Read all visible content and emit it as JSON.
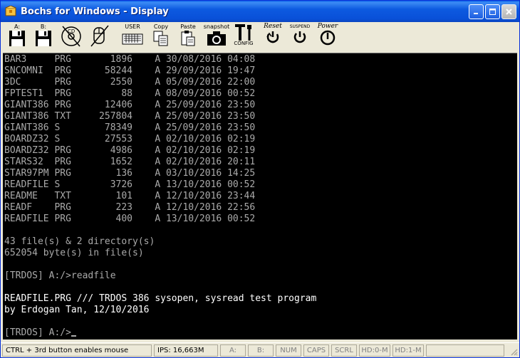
{
  "window": {
    "title": "Bochs for Windows - Display"
  },
  "toolbar": {
    "floppy_a": "A:",
    "floppy_b": "B:",
    "cdrom": "CD",
    "user": "USER",
    "copy": "Copy",
    "paste": "Paste",
    "snapshot": "snapshot",
    "config": "CONFIG",
    "reset": "Reset",
    "suspend": "SUSPEND",
    "power": "Power"
  },
  "console": {
    "lines": [
      "BAR3     PRG       1896    A 30/08/2016 04:08",
      "SNCOMNI  PRG      58244    A 29/09/2016 19:47",
      "3DC      PRG       2550    A 05/09/2016 22:00",
      "FPTEST1  PRG         88    A 08/09/2016 00:52",
      "GIANT386 PRG      12406    A 25/09/2016 23:50",
      "GIANT386 TXT     257804    A 25/09/2016 23:50",
      "GIANT386 S        78349    A 25/09/2016 23:50",
      "BOARDZ32 S        27553    A 02/10/2016 02:19",
      "BOARDZ32 PRG       4986    A 02/10/2016 02:19",
      "STARS32  PRG       1652    A 02/10/2016 20:11",
      "STAR97PM PRG        136    A 03/10/2016 14:25",
      "READFILE S         3726    A 13/10/2016 00:52",
      "README   TXT        101    A 12/10/2016 23:44",
      "READF    PRG        223    A 12/10/2016 22:56",
      "READFILE PRG        400    A 13/10/2016 00:52",
      "",
      "43 file(s) & 2 directory(s)",
      "652054 byte(s) in file(s)",
      "",
      "[TRDOS] A:/>readfile",
      "",
      "READFILE.PRG /// TRDOS 386 sysopen, sysread test program",
      "by Erdogan Tan, 12/10/2016",
      "",
      "[TRDOS] A:/>"
    ]
  },
  "statusbar": {
    "hint": "CTRL + 3rd button enables mouse",
    "ips": "IPS: 16,663M",
    "a": "A:",
    "b": "B:",
    "num": "NUM",
    "caps": "CAPS",
    "scrl": "SCRL",
    "hd0": "HD:0-M",
    "hd1": "HD:1-M"
  },
  "colors": {
    "title_bar": "#0a50d8",
    "console_bg": "#000000",
    "console_text": "#aaaaaa",
    "console_bright": "#ffffff"
  }
}
